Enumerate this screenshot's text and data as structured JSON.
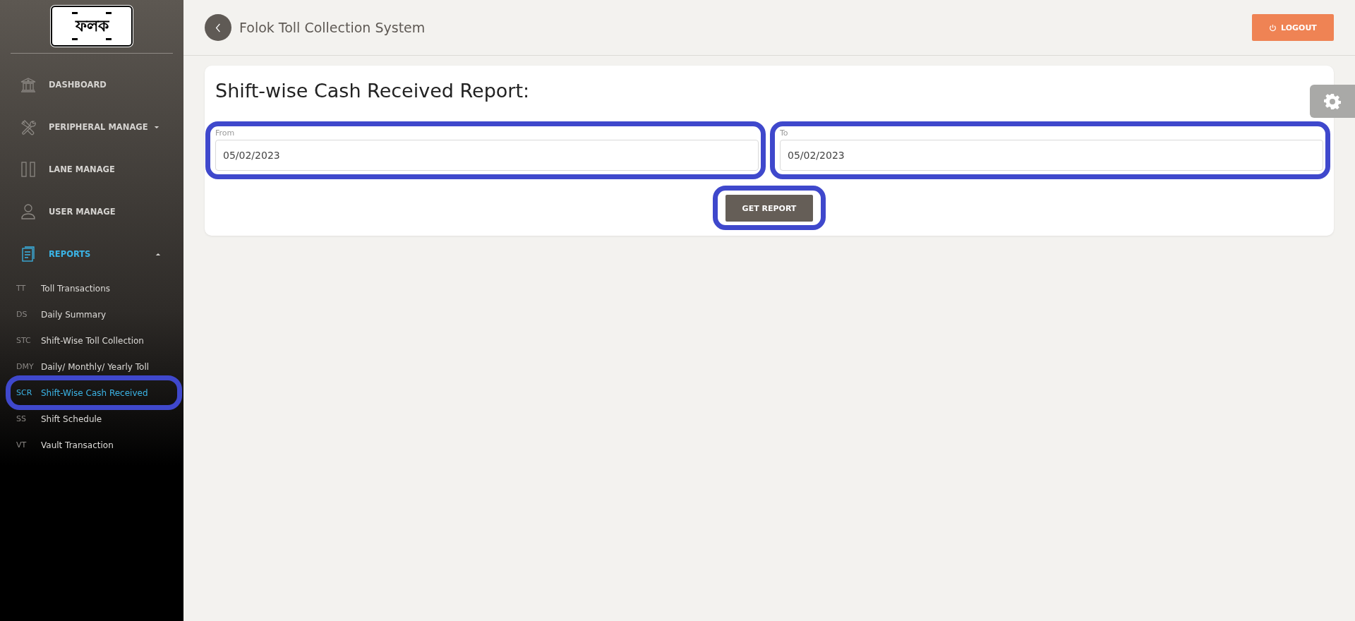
{
  "sidebar": {
    "logo": "ফলক",
    "items": [
      {
        "label": "DASHBOARD",
        "selected": false
      },
      {
        "label": "PERIPHERAL MANAGE",
        "selected": false,
        "expanded": false
      },
      {
        "label": "LANE MANAGE",
        "selected": false
      },
      {
        "label": "USER MANAGE",
        "selected": false
      },
      {
        "label": "REPORTS",
        "selected": true,
        "expanded": true,
        "children": [
          {
            "abbr": "TT",
            "label": "Toll Transactions",
            "selected": false,
            "highlighted": false
          },
          {
            "abbr": "DS",
            "label": "Daily Summary",
            "selected": false,
            "highlighted": false
          },
          {
            "abbr": "STC",
            "label": "Shift-Wise Toll Collection",
            "selected": false,
            "highlighted": false
          },
          {
            "abbr": "DMY",
            "label": "Daily/ Monthly/ Yearly Toll",
            "selected": false,
            "highlighted": false
          },
          {
            "abbr": "SCR",
            "label": "Shift-Wise Cash Received",
            "selected": true,
            "highlighted": true
          },
          {
            "abbr": "SS",
            "label": "Shift Schedule",
            "selected": false,
            "highlighted": false
          },
          {
            "abbr": "VT",
            "label": "Vault Transaction",
            "selected": false,
            "highlighted": false
          }
        ]
      }
    ]
  },
  "header": {
    "title": "Folok Toll Collection System",
    "logout": "LOGOUT"
  },
  "report": {
    "title": "Shift-wise Cash Received Report:",
    "fields": [
      {
        "label": "From",
        "value": "05/02/2023",
        "highlighted": true
      },
      {
        "label": "To",
        "value": "05/02/2023",
        "highlighted": true
      }
    ],
    "button": {
      "label": "GET REPORT",
      "highlighted": true
    }
  }
}
